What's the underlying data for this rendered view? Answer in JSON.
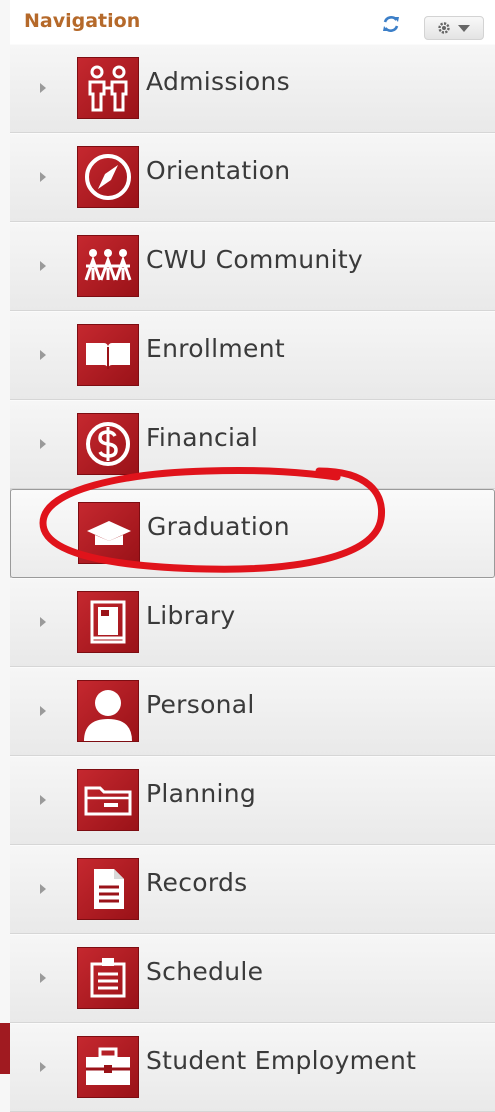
{
  "header": {
    "title": "Navigation",
    "refresh_icon": "refresh-icon",
    "menu_icon": "gear-icon"
  },
  "nav_items": [
    {
      "label": "Admissions",
      "icon": "people-icon"
    },
    {
      "label": "Orientation",
      "icon": "compass-icon"
    },
    {
      "label": "CWU Community",
      "icon": "community-icon"
    },
    {
      "label": "Enrollment",
      "icon": "book-icon"
    },
    {
      "label": "Financial",
      "icon": "dollar-icon"
    },
    {
      "label": "Graduation",
      "icon": "graduation-cap-icon",
      "selected": true
    },
    {
      "label": "Library",
      "icon": "library-book-icon"
    },
    {
      "label": "Personal",
      "icon": "person-icon"
    },
    {
      "label": "Planning",
      "icon": "folder-icon"
    },
    {
      "label": "Records",
      "icon": "document-icon"
    },
    {
      "label": "Schedule",
      "icon": "schedule-icon"
    },
    {
      "label": "Student Employment",
      "icon": "briefcase-icon"
    }
  ],
  "colors": {
    "accent_red": "#b01c22",
    "header_title": "#b5692a",
    "annotation_circle": "#e0131b"
  }
}
